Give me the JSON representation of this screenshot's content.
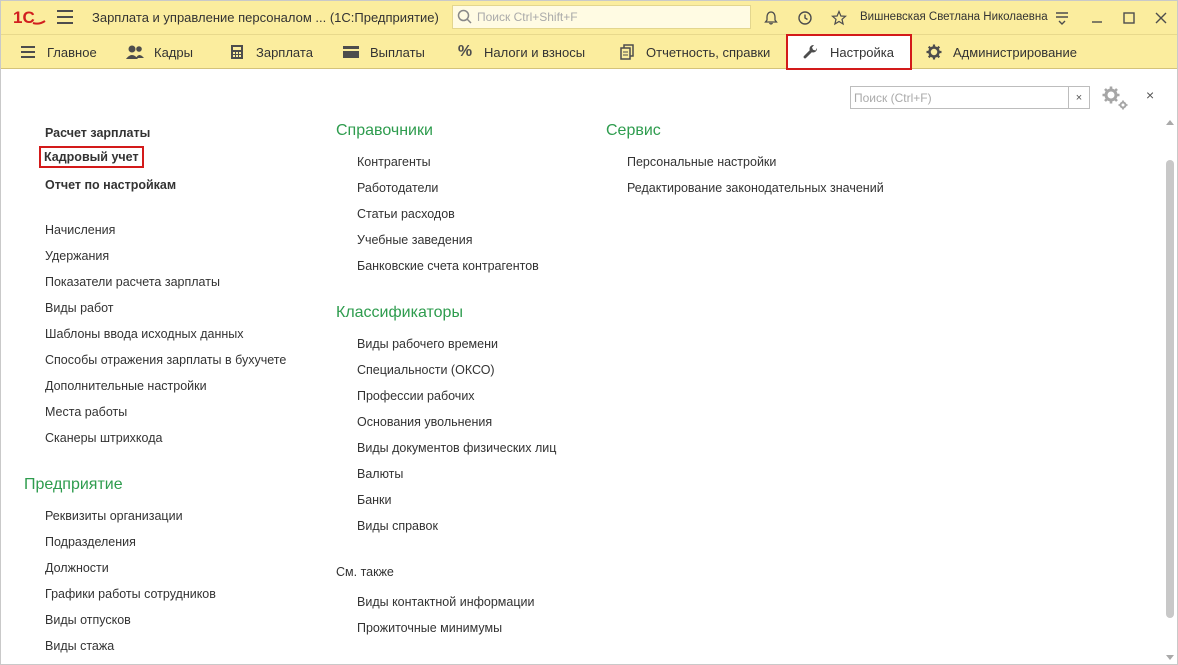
{
  "app": {
    "title": "Зарплата и управление персоналом ...  (1С:Предприятие)",
    "search_placeholder": "Поиск Ctrl+Shift+F",
    "user": "Вишневская Светлана Николаевна"
  },
  "sections": [
    {
      "label": "Главное",
      "icon": "menu-icon"
    },
    {
      "label": "Кадры",
      "icon": "people-icon"
    },
    {
      "label": "Зарплата",
      "icon": "calculator-icon"
    },
    {
      "label": "Выплаты",
      "icon": "wallet-icon"
    },
    {
      "label": "Налоги и взносы",
      "icon": "percent-icon"
    },
    {
      "label": "Отчетность, справки",
      "icon": "documents-icon"
    },
    {
      "label": "Настройка",
      "icon": "wrench-icon",
      "active": true
    },
    {
      "label": "Администрирование",
      "icon": "gear-icon"
    }
  ],
  "panel": {
    "search_placeholder": "Поиск (Ctrl+F)",
    "clear_label": "×",
    "close_label": "×"
  },
  "left": {
    "top_links": [
      "Расчет зарплаты",
      "Кадровый учет",
      "Отчет по настройкам"
    ],
    "links": [
      "Начисления",
      "Удержания",
      "Показатели расчета зарплаты",
      "Виды работ",
      "Шаблоны ввода исходных данных",
      "Способы отражения зарплаты в бухучете",
      "Дополнительные настройки",
      "Места работы",
      "Сканеры штрихкода"
    ],
    "enterprise_heading": "Предприятие",
    "enterprise_links": [
      "Реквизиты организации",
      "Подразделения",
      "Должности",
      "Графики работы сотрудников",
      "Виды отпусков",
      "Виды стажа"
    ]
  },
  "middle": {
    "ref_heading": "Справочники",
    "ref_links": [
      "Контрагенты",
      "Работодатели",
      "Статьи расходов",
      "Учебные заведения",
      "Банковские счета контрагентов"
    ],
    "cls_heading": "Классификаторы",
    "cls_links": [
      "Виды рабочего времени",
      "Специальности (ОКСО)",
      "Профессии рабочих",
      "Основания увольнения",
      "Виды документов физических лиц",
      "Валюты",
      "Банки",
      "Виды справок"
    ],
    "see_also_heading": "См. также",
    "see_also_links": [
      "Виды контактной информации",
      "Прожиточные минимумы"
    ]
  },
  "right": {
    "service_heading": "Сервис",
    "service_links": [
      "Персональные настройки",
      "Редактирование законодательных значений"
    ]
  },
  "colors": {
    "titlebar_bg": "#fbed9e",
    "heading_green": "#2e9c4e",
    "highlight_red": "#d31a1a"
  }
}
